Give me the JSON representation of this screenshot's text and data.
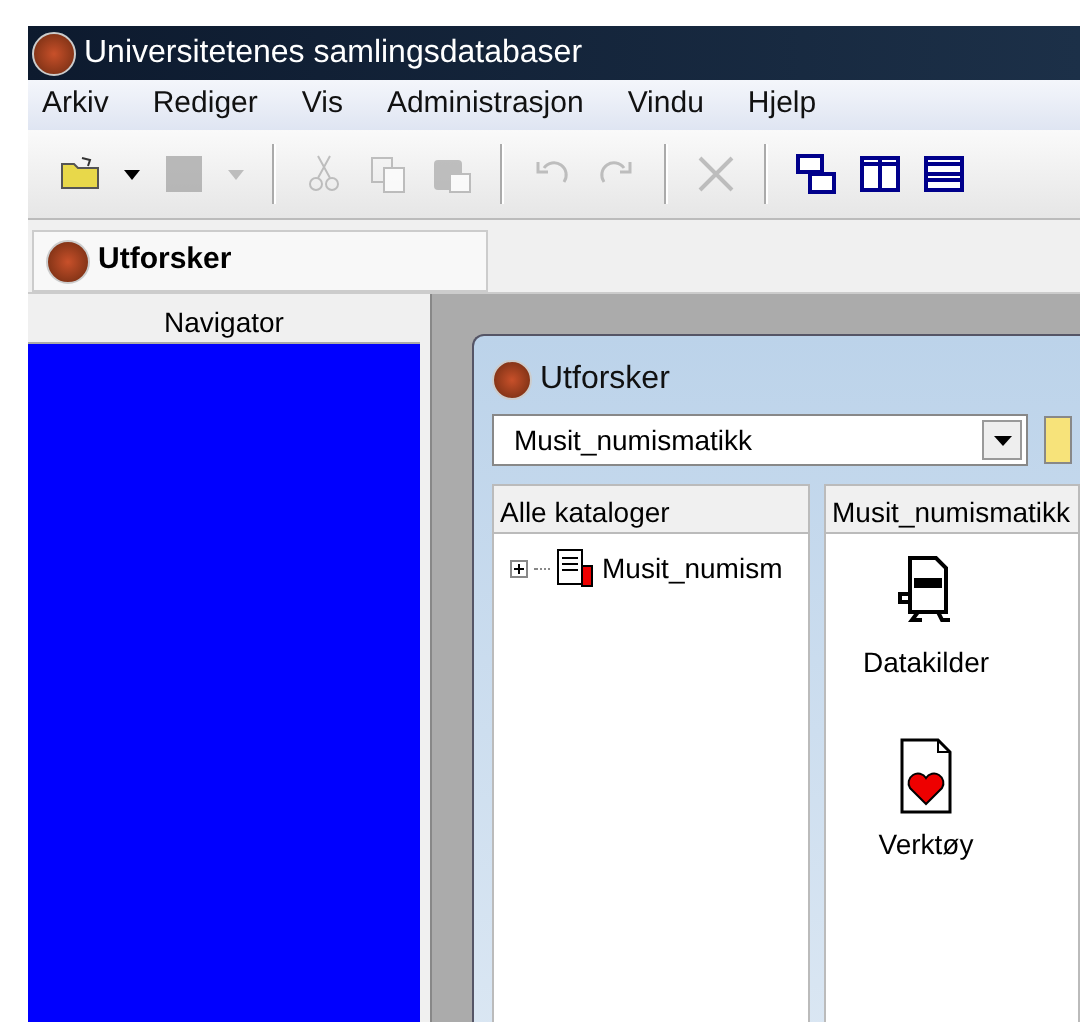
{
  "window": {
    "title": "Universitetenes samlingsdatabaser"
  },
  "menu": [
    "Arkiv",
    "Rediger",
    "Vis",
    "Administrasjon",
    "Vindu",
    "Hjelp"
  ],
  "toolbar": [
    {
      "kind": "open",
      "disabled": false
    },
    {
      "kind": "dropdown",
      "disabled": false
    },
    {
      "kind": "square",
      "disabled": true
    },
    {
      "kind": "dropdown",
      "disabled": true
    },
    {
      "kind": "sep"
    },
    {
      "kind": "cut",
      "disabled": true
    },
    {
      "kind": "copy",
      "disabled": true
    },
    {
      "kind": "paste",
      "disabled": true
    },
    {
      "kind": "sep"
    },
    {
      "kind": "undo",
      "disabled": true
    },
    {
      "kind": "redo",
      "disabled": true
    },
    {
      "kind": "sep"
    },
    {
      "kind": "delete",
      "disabled": true
    },
    {
      "kind": "sep"
    },
    {
      "kind": "cascade",
      "disabled": false
    },
    {
      "kind": "tile-v",
      "disabled": false
    },
    {
      "kind": "tile-h",
      "disabled": false
    }
  ],
  "doc_tabs": [
    {
      "label": "Utforsker",
      "selected": true
    }
  ],
  "navigator": {
    "title": "Navigator"
  },
  "explorer": {
    "title": "Utforsker",
    "database": "Musit_numismatikk",
    "tree": {
      "header": "Alle kataloger",
      "items": [
        {
          "label": "Musit_numism",
          "expanded": false
        }
      ]
    },
    "list": {
      "header": "Musit_numismatikk",
      "items": [
        {
          "kind": "datasource",
          "label": "Datakilder"
        },
        {
          "kind": "tools",
          "label": "Verktøy"
        }
      ]
    }
  }
}
